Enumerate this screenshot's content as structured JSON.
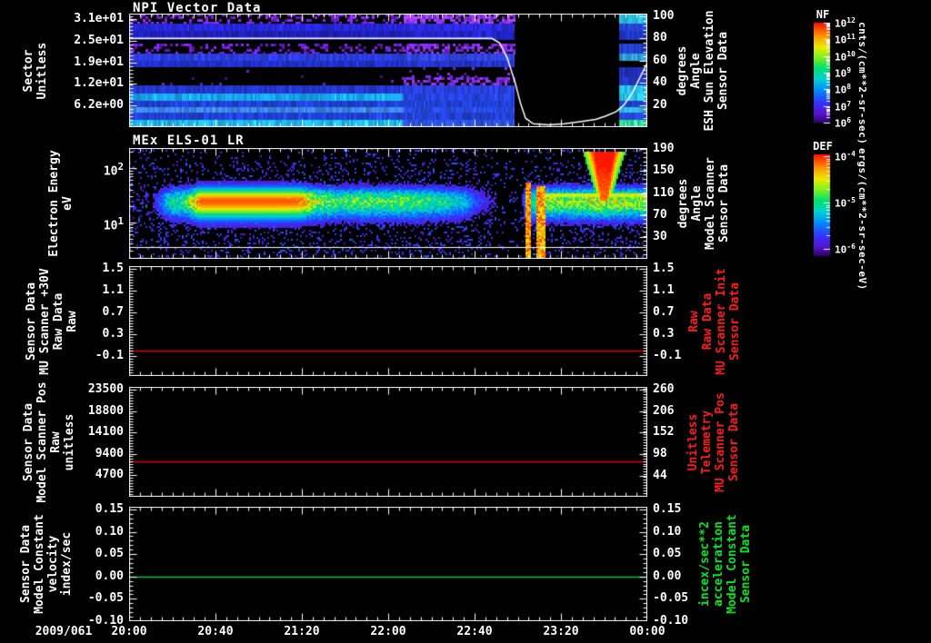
{
  "window": {
    "background": "#000000",
    "text_color": "#ffffff"
  },
  "xaxis": {
    "date_label": "2009/061",
    "tick_labels": [
      "20:00",
      "20:40",
      "21:20",
      "22:00",
      "22:40",
      "23:20",
      "00:00"
    ]
  },
  "chart_data": [
    {
      "id": "npi",
      "type": "heatmap",
      "title": "NPI Vector Data",
      "ylabel_lines": [
        "Sector",
        "Unitless"
      ],
      "ylim": [
        0,
        32.6
      ],
      "ytick_values": [
        31,
        24.8,
        18.6,
        12.4,
        6.2
      ],
      "ytick_labels": [
        "3.1e+01",
        "2.5e+01",
        "1.9e+01",
        "1.2e+01",
        "6.2e+00"
      ],
      "y_minor_step": 1.03,
      "right_axis": {
        "lines": [
          "Sensor Data",
          "ESH Sun Elevation",
          "Angle",
          "degrees"
        ],
        "color": "#ffffff",
        "ylim": [
          0,
          102.4
        ],
        "tick_values": [
          100,
          80,
          60,
          40,
          20
        ],
        "tick_labels": [
          "100",
          "80",
          "60",
          "40",
          "20"
        ],
        "minor_step": 4
      },
      "colorbar": {
        "label": "NF",
        "tick_labels": [
          "10^12",
          "10^11",
          "10^10",
          "10^9",
          "10^8",
          "10^7",
          "10^6"
        ],
        "units": "cnts/(cm**2-sr-sec)"
      },
      "overlay_line": {
        "name": "esh-sun-elevation-curve",
        "color": "#ffffff",
        "points_frac_value": [
          [
            0,
            80
          ],
          [
            0.7,
            80
          ],
          [
            0.715,
            76
          ],
          [
            0.73,
            62
          ],
          [
            0.745,
            40
          ],
          [
            0.755,
            22
          ],
          [
            0.765,
            8
          ],
          [
            0.78,
            3
          ],
          [
            0.81,
            2
          ],
          [
            0.84,
            3
          ],
          [
            0.87,
            5
          ],
          [
            0.9,
            7
          ],
          [
            0.92,
            10
          ],
          [
            0.94,
            14
          ],
          [
            0.955,
            20
          ],
          [
            0.97,
            30
          ],
          [
            0.985,
            44
          ],
          [
            1.0,
            58
          ]
        ]
      },
      "gap_x_frac": [
        0.744,
        0.946
      ],
      "mode_change_x_frac": 0.53,
      "bands": [
        {
          "y0": 0.0,
          "y1": 0.085,
          "pre": {
            "kind": "speckle",
            "color": "#7722dd",
            "density": 0.4
          },
          "post": {
            "kind": "speckle",
            "color": "#8833ee",
            "density": 0.65
          },
          "right": {
            "kind": "solid",
            "color": "#28c0e0"
          }
        },
        {
          "y0": 0.085,
          "y1": 0.155,
          "pre": {
            "kind": "solid",
            "color": "#2626d8"
          },
          "post": {
            "kind": "solid",
            "color": "#2a2ae2"
          },
          "right": {
            "kind": "solid",
            "color": "#2848e0"
          }
        },
        {
          "y0": 0.155,
          "y1": 0.235,
          "pre": {
            "kind": "solid",
            "color": "#1f1fb8"
          },
          "post": {
            "kind": "solid",
            "color": "#2222c4"
          },
          "right": {
            "kind": "solid",
            "color": "#2038c8"
          }
        },
        {
          "y0": 0.26,
          "y1": 0.35,
          "pre": {
            "kind": "speckle",
            "color": "#6a1cd0",
            "density": 0.32
          },
          "post": {
            "kind": "speckle",
            "color": "#7a28e0",
            "density": 0.62
          },
          "right": {
            "kind": "solid",
            "color": "#2440cc"
          }
        },
        {
          "y0": 0.35,
          "y1": 0.415,
          "pre": {
            "kind": "solid",
            "color": "#2a3ad8"
          },
          "post": {
            "kind": "solid",
            "color": "#3044e0"
          },
          "right": {
            "kind": "solid",
            "color": "#30a0d8"
          }
        },
        {
          "y0": 0.415,
          "y1": 0.47,
          "pre": {
            "kind": "solid",
            "color": "#2030c8"
          },
          "post": {
            "kind": "solid",
            "color": "#2434cc"
          },
          "right": {
            "kind": "black"
          }
        },
        {
          "y0": 0.47,
          "y1": 0.56,
          "pre": {
            "kind": "speckle",
            "color": "#5518aa",
            "density": 0.02
          },
          "post": {
            "kind": "speckle",
            "color": "#6a20c8",
            "density": 0.1
          },
          "right": {
            "kind": "solid",
            "color": "#2030b8"
          }
        },
        {
          "y0": 0.56,
          "y1": 0.63,
          "pre": {
            "kind": "speckle",
            "color": "#5518aa",
            "density": 0.03
          },
          "post": {
            "kind": "speckle",
            "color": "#7a28dd",
            "density": 0.55
          },
          "right": {
            "kind": "solid",
            "color": "#2438c8"
          }
        },
        {
          "y0": 0.63,
          "y1": 0.705,
          "pre": {
            "kind": "solid",
            "color": "#2336cc"
          },
          "post": {
            "kind": "solid",
            "color": "#2a40dd"
          },
          "right": {
            "kind": "solid",
            "color": "#28b8e4"
          }
        },
        {
          "y0": 0.705,
          "y1": 0.765,
          "pre": {
            "kind": "solid",
            "color": "#17a5ef"
          },
          "post": {
            "kind": "solid",
            "color": "#2442dd"
          },
          "right": {
            "kind": "solid",
            "color": "#2ac4ea"
          }
        },
        {
          "y0": 0.765,
          "y1": 0.825,
          "pre": {
            "kind": "solid",
            "color": "#2040d4"
          },
          "post": {
            "kind": "solid",
            "color": "#2040d4"
          },
          "right": {
            "kind": "solid",
            "color": "#2444d8"
          }
        },
        {
          "y0": 0.825,
          "y1": 0.875,
          "pre": {
            "kind": "solid",
            "color": "#3a85e8"
          },
          "post": {
            "kind": "solid",
            "color": "#2848dd"
          },
          "right": {
            "kind": "solid",
            "color": "#30b0e0"
          }
        },
        {
          "y0": 0.875,
          "y1": 0.935,
          "pre": {
            "kind": "solid",
            "color": "#2141d6"
          },
          "post": {
            "kind": "solid",
            "color": "#2141d6"
          },
          "right": {
            "kind": "solid",
            "color": "#2646da"
          }
        },
        {
          "y0": 0.935,
          "y1": 1.0,
          "pre": {
            "kind": "solid",
            "color": "#1fb9ef"
          },
          "post": {
            "kind": "solid",
            "color": "#2c52e0"
          },
          "right": {
            "kind": "solid",
            "color": "#2ee09a"
          }
        }
      ]
    },
    {
      "id": "els",
      "type": "heatmap",
      "title": "MEx ELS-01 LR",
      "ylabel_lines": [
        "Electron Energy",
        "eV"
      ],
      "ylog": true,
      "ylim": [
        2.1,
        234
      ],
      "ytick_values": [
        100,
        10
      ],
      "ytick_labels": [
        "10^2",
        "10^1"
      ],
      "right_axis": {
        "lines": [
          "Sensor Data",
          "Model Scanner",
          "Angle",
          "degrees"
        ],
        "color": "#ffffff",
        "ylim": [
          -9,
          192
        ],
        "tick_values": [
          190,
          150,
          110,
          70,
          30
        ],
        "tick_labels": [
          "190",
          "150",
          "110",
          "70",
          "30"
        ],
        "minor_step": 8
      },
      "colorbar": {
        "label": "DEF",
        "tick_labels": [
          "10^-4",
          "10^-5",
          "10^-6"
        ],
        "units": "ergs/(cm**2-sr-sec-eV)"
      },
      "white_line_y_frac": 0.89,
      "band_center_y_frac": 0.47,
      "band_profile": [
        [
          0,
          0
        ],
        [
          0.04,
          0.05
        ],
        [
          0.06,
          0.3
        ],
        [
          0.08,
          0.55
        ],
        [
          0.11,
          0.6
        ],
        [
          0.13,
          0.75
        ],
        [
          0.15,
          0.9
        ],
        [
          0.18,
          0.95
        ],
        [
          0.22,
          0.9
        ],
        [
          0.26,
          0.9
        ],
        [
          0.3,
          0.85
        ],
        [
          0.34,
          0.72
        ],
        [
          0.38,
          0.68
        ],
        [
          0.41,
          0.6
        ],
        [
          0.44,
          0.66
        ],
        [
          0.48,
          0.62
        ],
        [
          0.52,
          0.66
        ],
        [
          0.56,
          0.6
        ],
        [
          0.6,
          0.55
        ],
        [
          0.64,
          0.45
        ],
        [
          0.67,
          0.25
        ],
        [
          0.7,
          0.12
        ],
        [
          0.73,
          0.05
        ],
        [
          0.755,
          0.05
        ],
        [
          0.768,
          0.5
        ],
        [
          0.79,
          0.65
        ],
        [
          0.81,
          0.72
        ],
        [
          0.85,
          0.7
        ],
        [
          0.88,
          0.74
        ],
        [
          0.91,
          0.78
        ],
        [
          0.94,
          0.76
        ],
        [
          0.97,
          0.72
        ],
        [
          1.0,
          0.7
        ]
      ],
      "red_blobs": [
        [
          0.15,
          0.55
        ],
        [
          0.175,
          0.6
        ],
        [
          0.205,
          0.55
        ],
        [
          0.24,
          0.5
        ],
        [
          0.285,
          0.45
        ],
        [
          0.325,
          0.35
        ]
      ],
      "plume": {
        "x0": 0.878,
        "x1": 0.952,
        "y0": 0.03,
        "y1": 0.47
      },
      "stripes": [
        {
          "x0": 0.762,
          "x1": 0.773,
          "y0": 0.3
        },
        {
          "x0": 0.783,
          "x1": 0.8,
          "y0": 0.33
        }
      ],
      "yellow_line": {
        "x0": 0.8,
        "x1": 1.0,
        "y_frac": 0.415
      }
    },
    {
      "id": "mu-scanner-30v",
      "type": "line",
      "left_lines": [
        "Sensor Data",
        "MU Scanner +30V",
        "Raw Data",
        "Raw"
      ],
      "right_lines": [
        "Sensor Data",
        "MU Scanner Init",
        "Raw Data",
        "Raw"
      ],
      "right_color": "#ff1a1a",
      "ylim": [
        -0.467,
        1.55
      ],
      "ytick_values": [
        1.5,
        1.1,
        0.7,
        0.3,
        -0.1
      ],
      "ytick_labels": [
        "1.5",
        "1.1",
        "0.7",
        "0.3",
        "-0.1"
      ],
      "y_minor_step": 0.05,
      "series": [
        {
          "name": "mu-scanner-raw",
          "color": "#dd0000",
          "value": 0.0
        }
      ]
    },
    {
      "id": "model-scanner-pos",
      "type": "line",
      "left_lines": [
        "Sensor Data",
        "Model Scanner Pos",
        "Raw",
        "unitless"
      ],
      "right_lines": [
        "Sensor Data",
        "MU Scanner Pos",
        "Telemetry",
        "Unitless"
      ],
      "right_color": "#ff1a1a",
      "ylim": [
        -100,
        24100
      ],
      "ytick_values": [
        23500,
        18800,
        14100,
        9400,
        4700
      ],
      "ytick_labels": [
        "23500",
        "18800",
        "14100",
        "9400",
        "4700"
      ],
      "y_minor_step": 587.5,
      "right_axis": {
        "ylim": [
          -9,
          267
        ],
        "tick_values": [
          260,
          206,
          152,
          98,
          44
        ],
        "tick_labels": [
          "260",
          "206",
          "152",
          "98",
          "44"
        ],
        "minor_step": 6.75
      },
      "series": [
        {
          "name": "scanner-pos-raw",
          "color": "#dd0000",
          "value": 7700,
          "value_right_scale": 78
        }
      ]
    },
    {
      "id": "model-constant-velocity",
      "type": "line",
      "left_lines": [
        "Sensor Data",
        "Model Constant",
        "velocity",
        "index/sec"
      ],
      "right_lines": [
        "Sensor Data",
        "Model Constant",
        "acceleration",
        "incex/sec**2"
      ],
      "right_color": "#00e81e",
      "ylim": [
        -0.1,
        0.156
      ],
      "ytick_values": [
        0.15,
        0.1,
        0.05,
        0.0,
        -0.05,
        -0.1
      ],
      "ytick_labels": [
        "0.15",
        "0.10",
        "0.05",
        "0.00",
        "-0.05",
        "-0.10"
      ],
      "y_minor_step": 0.01,
      "series": [
        {
          "name": "model-constant-velocity",
          "color": "#00c040",
          "value": 0.0
        }
      ]
    }
  ]
}
